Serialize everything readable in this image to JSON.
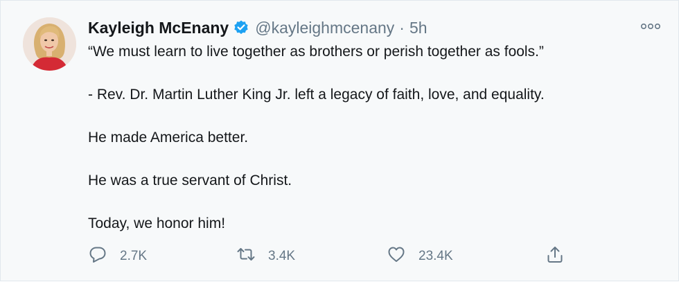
{
  "author": {
    "name": "Kayleigh McEnany",
    "handle": "@kayleighmcenany",
    "separator": "·",
    "time": "5h",
    "verified": true
  },
  "body": [
    "“We must learn to live together as brothers or perish together as fools.”",
    "- Rev. Dr. Martin Luther King Jr. left a legacy of faith, love, and equality.",
    "He made America better.",
    "He was a true servant of Christ.",
    "Today, we honor him!"
  ],
  "actions": {
    "reply": {
      "icon": "reply-icon",
      "count": "2.7K"
    },
    "retweet": {
      "icon": "retweet-icon",
      "count": "3.4K"
    },
    "like": {
      "icon": "heart-icon",
      "count": "23.4K"
    },
    "share": {
      "icon": "share-icon"
    }
  },
  "more_icon": "more-icon",
  "colors": {
    "verified": "#1da1f2",
    "text": "#14171a",
    "secondary": "#657786",
    "background": "#f7f9fa"
  }
}
